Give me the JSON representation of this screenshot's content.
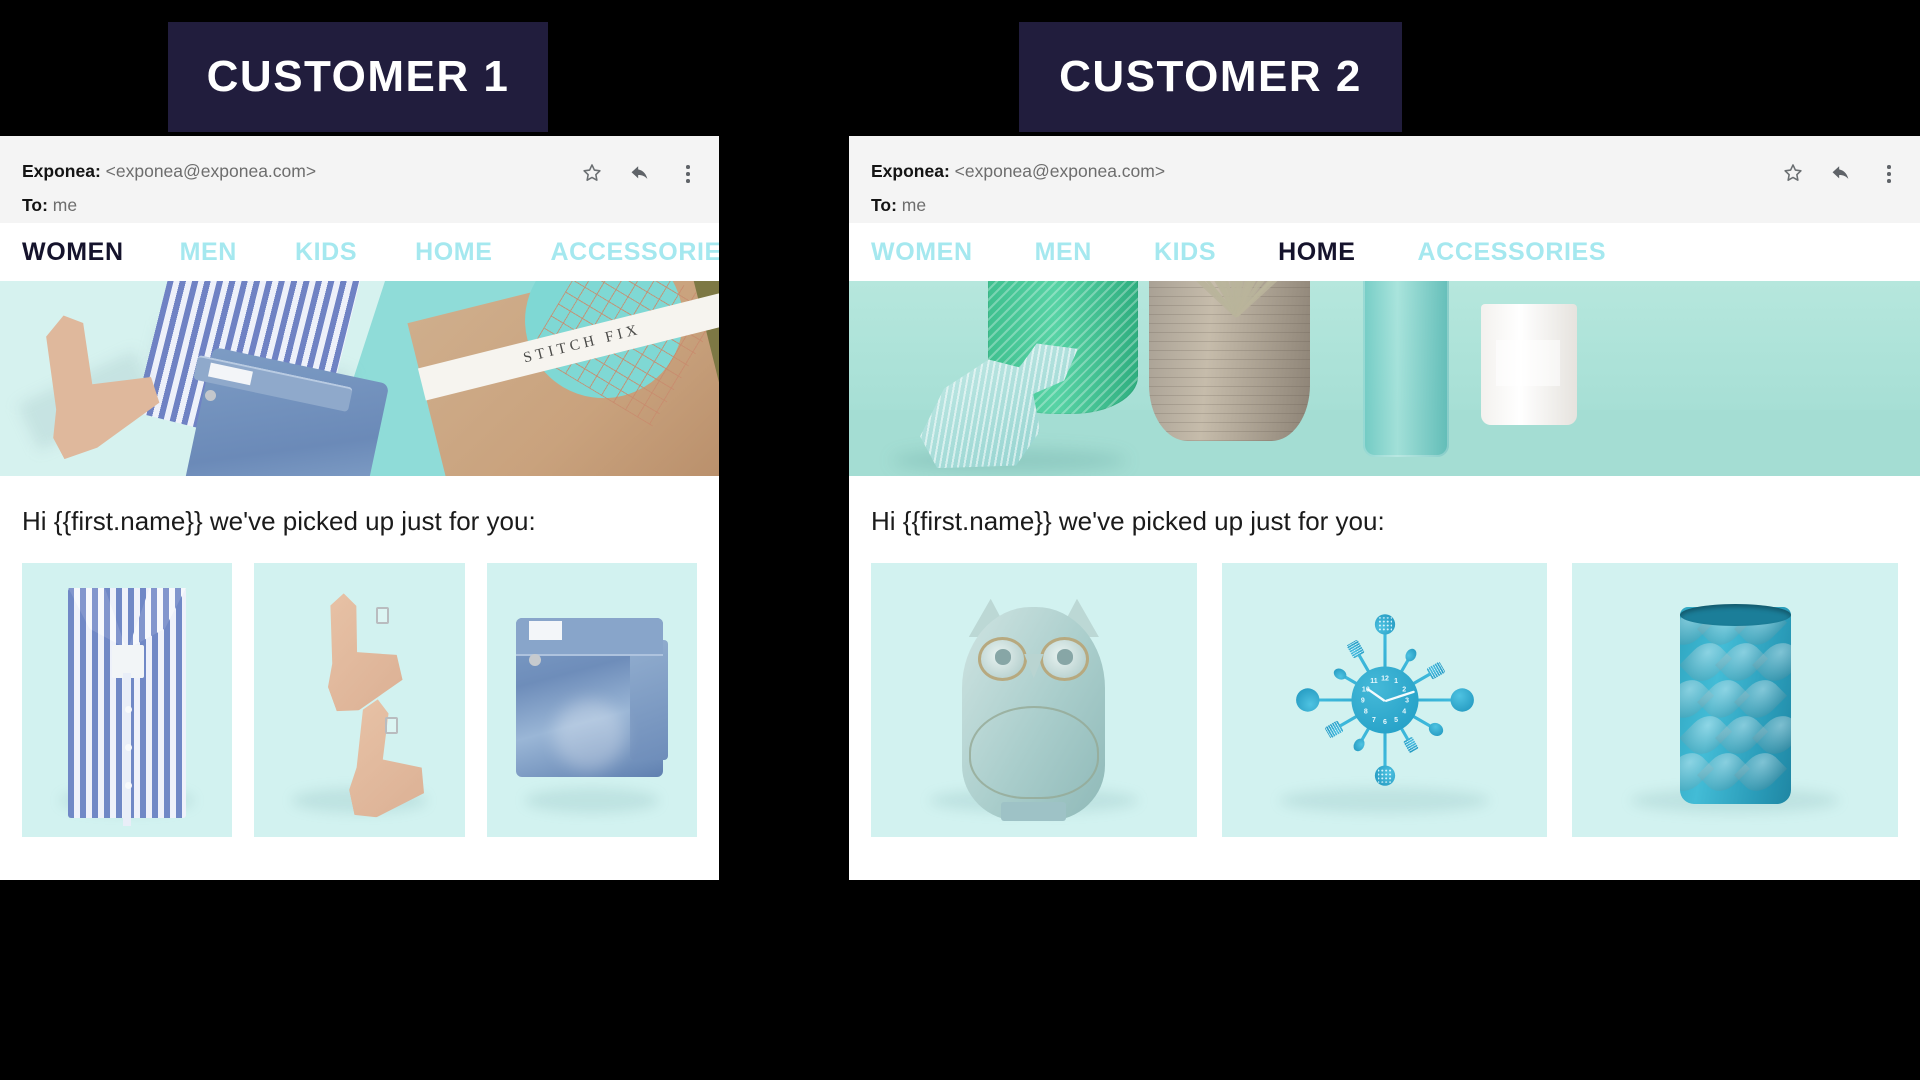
{
  "badges": [
    {
      "label": "CUSTOMER 1"
    },
    {
      "label": "CUSTOMER 2"
    }
  ],
  "panels": [
    {
      "id": "customer-1",
      "email": {
        "from_label": "Exponea:",
        "from_value": "<exponea@exponea.com>",
        "to_label": "To:",
        "to_value": "me",
        "actions": [
          {
            "name": "star-icon",
            "title": "Star"
          },
          {
            "name": "reply-icon",
            "title": "Reply"
          },
          {
            "name": "more-options-icon",
            "title": "More"
          }
        ]
      },
      "nav": [
        {
          "label": "WOMEN",
          "active": true
        },
        {
          "label": "MEN",
          "active": false
        },
        {
          "label": "KIDS",
          "active": false
        },
        {
          "label": "HOME",
          "active": false
        },
        {
          "label": "ACCESSORIES",
          "active": false
        }
      ],
      "hero": {
        "alt": "Flat-lay of nude heels, blue striped shirt, folded jeans and a Stitch Fix box on mint background",
        "box_text": "STITCH FIX"
      },
      "greeting": "Hi {{first.name}} we've picked up just for you:",
      "products": [
        {
          "alt": "Blue and white striped button-down shirt, folded"
        },
        {
          "alt": "Pair of nude block-heel sandals"
        },
        {
          "alt": "Folded light-wash blue jeans"
        }
      ]
    },
    {
      "id": "customer-2",
      "email": {
        "from_label": "Exponea:",
        "from_value": "<exponea@exponea.com>",
        "to_label": "To:",
        "to_value": "me",
        "actions": [
          {
            "name": "star-icon",
            "title": "Star"
          },
          {
            "name": "reply-icon",
            "title": "Reply"
          },
          {
            "name": "more-options-icon",
            "title": "More"
          }
        ]
      },
      "nav": [
        {
          "label": "WOMEN",
          "active": false
        },
        {
          "label": "MEN",
          "active": false
        },
        {
          "label": "KIDS",
          "active": false
        },
        {
          "label": "HOME",
          "active": true
        },
        {
          "label": "ACCESSORIES",
          "active": false
        }
      ],
      "hero": {
        "alt": "Home decor still life: ceramic toucan, green textured vase, stoneware planter with air plant, glass bottle and candle on mint background"
      },
      "greeting": "Hi {{first.name}} we've picked up just for you:",
      "products": [
        {
          "alt": "Pale blue ceramic owl figurine"
        },
        {
          "alt": "Teal cutlery wall clock made of spoons and forks"
        },
        {
          "alt": "Teal ceramic vase with embossed petal pattern"
        }
      ]
    }
  ],
  "colors": {
    "badge_bg": "#211d3d",
    "badge_text": "#ffffff",
    "page_bg": "#000000",
    "mail_header_bg": "#f4f4f4",
    "nav_inactive": "#a5e8ef",
    "nav_active": "#15132c",
    "tile_bg": "#d2f2f0",
    "body_text": "#1b1b1b"
  },
  "clock_numbers": [
    "12",
    "1",
    "2",
    "3",
    "4",
    "5",
    "6",
    "7",
    "8",
    "9",
    "10",
    "11"
  ]
}
